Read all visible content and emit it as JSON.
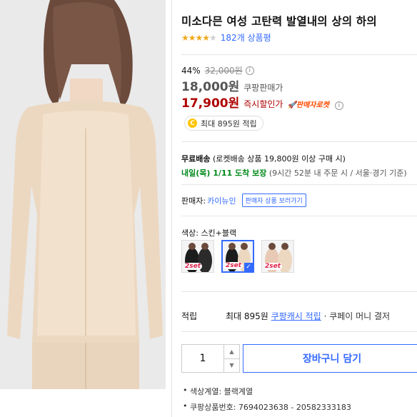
{
  "product": {
    "title": "미소다믄 여성 고탄력 발열내의 상의 하의",
    "rating_value": 4,
    "rating_max": 5,
    "review_count": "182개 상품평"
  },
  "pricing": {
    "discount_rate": "44%",
    "original_price": "32,000원",
    "coupang_price": "18,000원",
    "coupang_price_label": "쿠팡판매가",
    "instant_price": "17,900원",
    "instant_price_label": "즉시할인가",
    "rocket_badge": "판매자로켓",
    "info_icon": "i"
  },
  "reward": {
    "coin": "C",
    "text": "최대 895원 적립"
  },
  "shipping": {
    "free_label": "무료배송",
    "free_detail": "(로켓배송 상품 19,800원 이상 구매 시)",
    "arrival": "내일(목) 1/11 도착 보장",
    "condition": "(9시간 52분  내 주문 시 / 서울⋅경기 기준)"
  },
  "seller": {
    "label": "판매자:",
    "name": "카이뉴인",
    "button": "판매자 상품 보러가기"
  },
  "options": {
    "color_label": "색상: 스킨+블랙",
    "swatches": [
      {
        "tag": "2set"
      },
      {
        "tag": "2set"
      },
      {
        "tag": "2set"
      }
    ]
  },
  "points": {
    "label": "적립",
    "max": "최대 895원",
    "cash_link": "쿠팡캐시 적립",
    "rest": "· 쿠페이 머니 결저"
  },
  "purchase": {
    "quantity": "1",
    "cart_button": "장바구니 담기"
  },
  "details": [
    "색상계열: 블랙계열",
    "쿠팡상품번호: 7694023638 - 20582333183"
  ],
  "colors": {
    "accent": "#346aff",
    "sale_red": "#ae0000",
    "star": "#f0a81c",
    "green": "#00891a"
  }
}
